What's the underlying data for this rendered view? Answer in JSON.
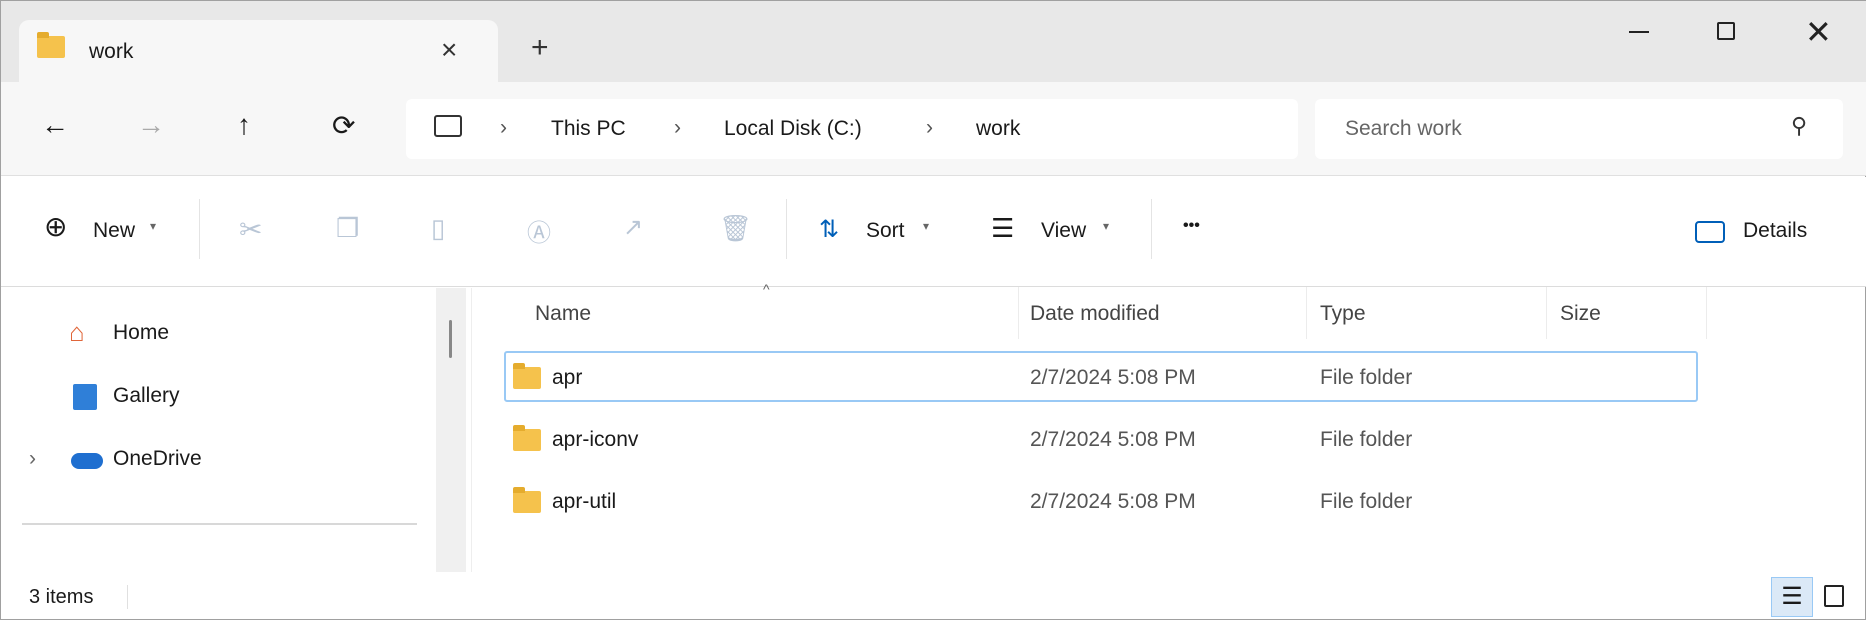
{
  "window": {
    "minimize_icon": "minimize-icon",
    "maximize_icon": "maximize-icon",
    "close_icon": "close-icon"
  },
  "tab": {
    "title": "work",
    "close": "×",
    "new_tab": "+"
  },
  "nav": {
    "back": "←",
    "forward": "→",
    "up": "↑",
    "refresh": "⟳"
  },
  "breadcrumb": {
    "items": [
      "This PC",
      "Local Disk (C:)",
      "work"
    ],
    "separator": "›"
  },
  "search": {
    "placeholder": "Search work"
  },
  "toolbar": {
    "new": "New",
    "sort": "Sort",
    "view": "View",
    "more": "•••",
    "details": "Details"
  },
  "sidebar": {
    "items": [
      {
        "label": "Home"
      },
      {
        "label": "Gallery"
      },
      {
        "label": "OneDrive"
      }
    ]
  },
  "columns": [
    "Name",
    "Date modified",
    "Type",
    "Size"
  ],
  "rows": [
    {
      "name": "apr",
      "date": "2/7/2024 5:08 PM",
      "type": "File folder",
      "size": ""
    },
    {
      "name": "apr-iconv",
      "date": "2/7/2024 5:08 PM",
      "type": "File folder",
      "size": ""
    },
    {
      "name": "apr-util",
      "date": "2/7/2024 5:08 PM",
      "type": "File folder",
      "size": ""
    }
  ],
  "status": {
    "count": "3 items"
  },
  "colors": {
    "accent": "#005fb8",
    "selection_border": "#99c9f5",
    "folder": "#f5c24c"
  }
}
